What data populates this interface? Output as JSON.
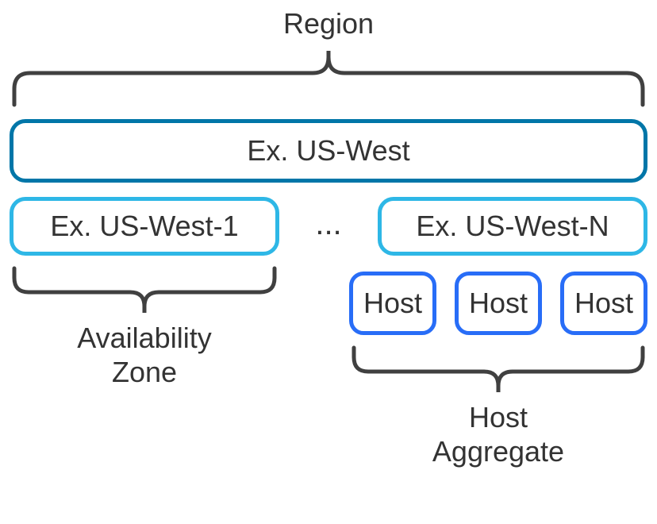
{
  "labels": {
    "region": "Region",
    "availability_zone": "Availability\nZone",
    "host_aggregate": "Host\nAggregate",
    "ellipsis": "..."
  },
  "region_box": {
    "text": "Ex. US-West"
  },
  "az_boxes": [
    {
      "text": "Ex. US-West-1"
    },
    {
      "text": "Ex. US-West-N"
    }
  ],
  "host_boxes": [
    {
      "text": "Host"
    },
    {
      "text": "Host"
    },
    {
      "text": "Host"
    }
  ],
  "colors": {
    "region_border": "#0076a8",
    "az_border": "#2eb7e6",
    "host_border": "#286df7",
    "brace": "#404040"
  }
}
